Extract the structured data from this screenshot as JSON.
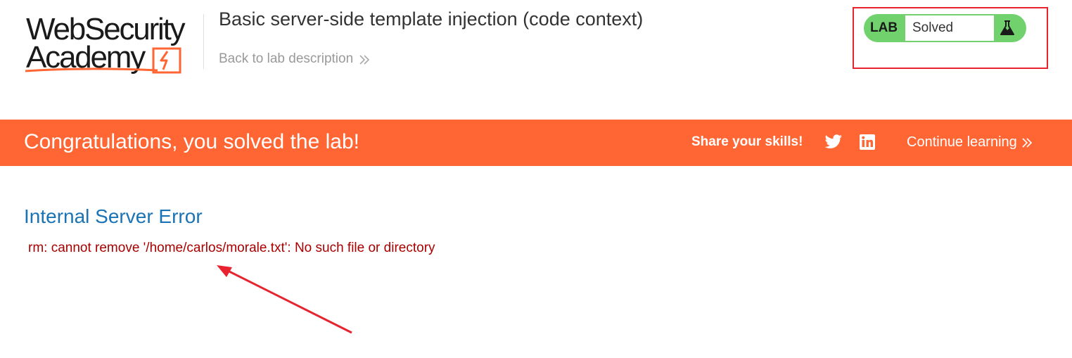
{
  "logo": {
    "line1": "WebSecurity",
    "line2": "Academy"
  },
  "lab": {
    "title": "Basic server-side template injection (code context)",
    "back_link": "Back to lab description"
  },
  "status": {
    "tag": "LAB",
    "value": "Solved",
    "icon": "flask-icon"
  },
  "banner": {
    "message": "Congratulations, you solved the lab!",
    "share_label": "Share your skills!",
    "continue_label": "Continue learning",
    "icons": [
      "twitter-icon",
      "linkedin-icon"
    ]
  },
  "error": {
    "heading": "Internal Server Error",
    "message": "rm: cannot remove '/home/carlos/morale.txt': No such file or directory"
  },
  "colors": {
    "brand_orange": "#ff6633",
    "solved_green": "#70d16d",
    "heading_blue": "#1a73b5",
    "error_red": "#aa0000",
    "annotation_red": "#e8232f"
  }
}
